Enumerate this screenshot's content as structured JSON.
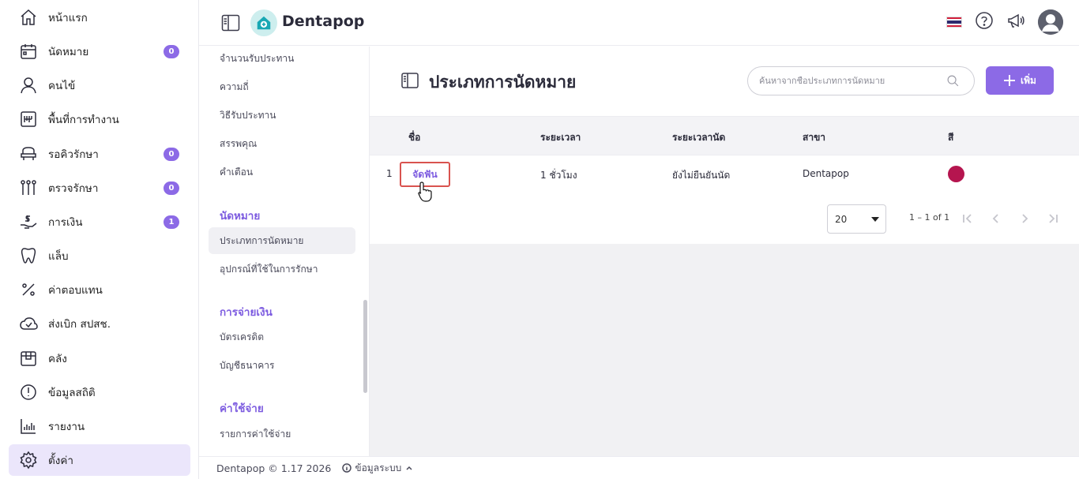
{
  "sidebar": {
    "items": [
      {
        "label": "หน้าแรก",
        "icon": "home-icon",
        "badge": null
      },
      {
        "label": "นัดหมาย",
        "icon": "calendar-icon",
        "badge": "0"
      },
      {
        "label": "คนไข้",
        "icon": "user-icon",
        "badge": null
      },
      {
        "label": "พื้นที่การทำงาน",
        "icon": "workspace-icon",
        "badge": null
      },
      {
        "label": "รอคิวรักษา",
        "icon": "dental-chair-icon",
        "badge": "0"
      },
      {
        "label": "ตรวจรักษา",
        "icon": "dental-tools-icon",
        "badge": "0"
      },
      {
        "label": "การเงิน",
        "icon": "money-hand-icon",
        "badge": "1"
      },
      {
        "label": "แล็บ",
        "icon": "tooth-icon",
        "badge": null
      },
      {
        "label": "ค่าตอบแทน",
        "icon": "percent-icon",
        "badge": null
      },
      {
        "label": "ส่งเบิก สปสช.",
        "icon": "cloud-check-icon",
        "badge": null
      },
      {
        "label": "คลัง",
        "icon": "box-icon",
        "badge": null
      },
      {
        "label": "ข้อมูลสถิติ",
        "icon": "gauge-icon",
        "badge": null
      },
      {
        "label": "รายงาน",
        "icon": "bar-chart-icon",
        "badge": null
      },
      {
        "label": "ตั้งค่า",
        "icon": "gear-icon",
        "badge": null,
        "active": true
      }
    ]
  },
  "topbar": {
    "brand": "Dentapop"
  },
  "submenu": {
    "items_top": [
      "จำนวนรับประทาน",
      "ความถี่",
      "วิธีรับประทาน",
      "สรรพคุณ",
      "คำเตือน"
    ],
    "group_appointments": "นัดหมาย",
    "appointments": [
      "ประเภทการนัดหมาย",
      "อุปกรณ์ที่ใช้ในการรักษา"
    ],
    "group_payment": "การจ่ายเงิน",
    "payment": [
      "บัตรเครดิต",
      "บัญชีธนาคาร"
    ],
    "group_expense": "ค่าใช้จ่าย",
    "expense": [
      "รายการค่าใช้จ่าย"
    ]
  },
  "page": {
    "title": "ประเภทการนัดหมาย",
    "search_placeholder": "ค้นหาจากชื่อประเภทการนัดหมาย",
    "add_label": "เพิ่ม"
  },
  "table": {
    "headers": [
      "ชื่อ",
      "ระยะเวลา",
      "ระยะเวลานัด",
      "สาขา",
      "สี"
    ],
    "rows": [
      {
        "index": "1",
        "name": "จัดฟัน",
        "duration": "1 ชั่วโมง",
        "appointment_period": "ยังไม่ยืนยันนัด",
        "branch": "Dentapop",
        "color": "#b5154f"
      }
    ]
  },
  "pagination": {
    "page_size": "20",
    "range": "1 – 1 of 1"
  },
  "footer": {
    "copyright": "Dentapop © 1.17 2026",
    "system_info": "ข้อมูลระบบ"
  },
  "colors": {
    "accent": "#8c6ae6",
    "active_bg": "#ebe6fb",
    "highlight_border": "#d9534f"
  }
}
